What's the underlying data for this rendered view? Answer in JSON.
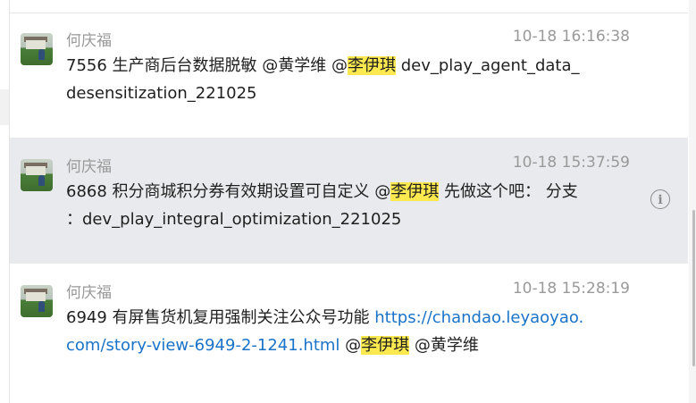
{
  "messages": [
    {
      "sender": "何庆福",
      "time": "10-18 16:16:38",
      "prefix": "7556 生产商后台数据脱敏 @黄学维 @",
      "hl": "李伊琪",
      "rest": " dev_play_agent_data_",
      "line2": "desensitization_221025"
    },
    {
      "sender": "何庆福",
      "time": "10-18 15:37:59",
      "prefix": "6868 积分商城积分券有效期设置可自定义 @",
      "hl": "李伊琪",
      "rest": " 先做这个吧： 分支",
      "line2": "：dev_play_integral_optimization_221025"
    },
    {
      "sender": "何庆福",
      "time": "10-18 15:28:19",
      "prefix": "6949 有屏售货机复用强制关注公众号功能 ",
      "link1": "https://chandao.leyaoyao.",
      "link2": "com/story-view-6949-2-1241.html",
      "mid": " @",
      "hl": "李伊琪",
      "rest": " @黄学维"
    }
  ],
  "icons": {
    "info": "info-icon",
    "avatar": "avatar"
  }
}
